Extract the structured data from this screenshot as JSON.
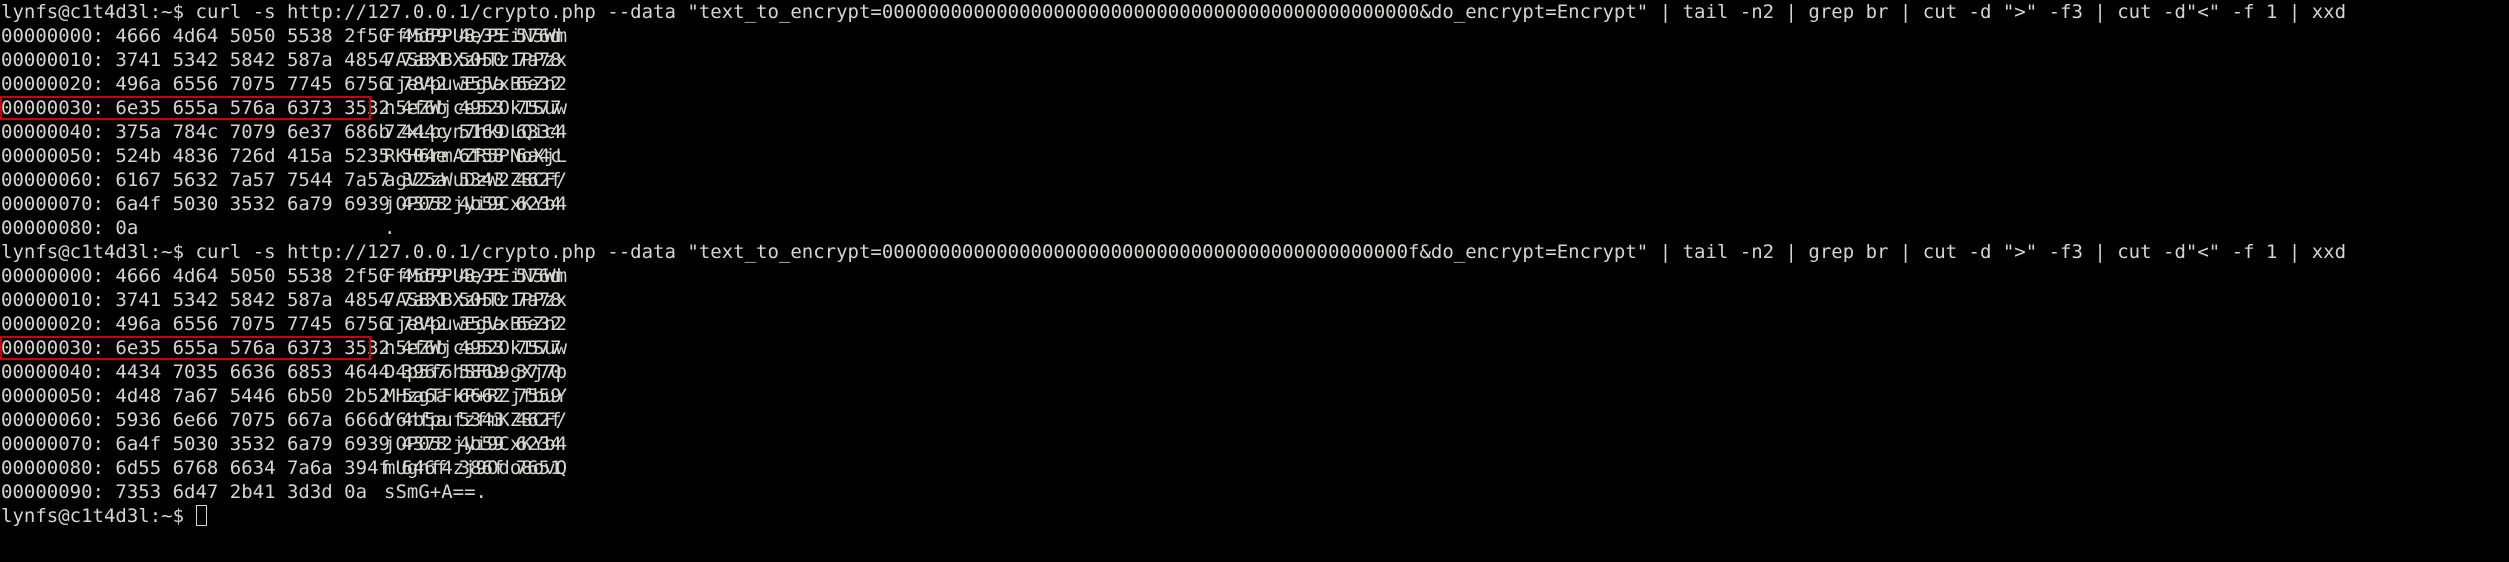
{
  "prompt": {
    "user_host": "lynfs@c1t4d3l",
    "path": ":~",
    "symbol": "$ "
  },
  "commands": [
    "curl -s http://127.0.0.1/crypto.php --data \"text_to_encrypt=00000000000000000000000000000000000000000000000&do_encrypt=Encrypt\" | tail -n2 | grep br | cut -d \">\" -f3 | cut -d\"<\" -f 1 | xxd",
    "curl -s http://127.0.0.1/crypto.php --data \"text_to_encrypt=0000000000000000000000000000000000000000000000f&do_encrypt=Encrypt\" | tail -n2 | grep br | cut -d \">\" -f3 | cut -d\"<\" -f 1 | xxd"
  ],
  "dumps": [
    [
      {
        "offset": "00000000:",
        "hex": "4666 4d64 5050 5538 2f50 4569 4e35 576d",
        "ascii": "FfMdPPU8/PEiN5Wm",
        "highlighted": false
      },
      {
        "offset": "00000010:",
        "hex": "3741 5342 5842 587a 4854 7a31 5050 7a78",
        "ascii": "7ASBXBXzHTz1PPzx",
        "highlighted": false
      },
      {
        "offset": "00000020:",
        "hex": "496a 6556 7075 7745 6756 7842 355a 6e32",
        "ascii": "IjeVpuwEgVxB5Zn2",
        "highlighted": false
      },
      {
        "offset": "00000030:",
        "hex": "6e35 655a 576a 6373 3532 4f6b 4953 7577",
        "ascii": "n5eZWjcs52OkISuw",
        "highlighted": true
      },
      {
        "offset": "00000040:",
        "hex": "375a 784c 7079 6e37 686b 444c 5169 6334",
        "ascii": "7ZxLpyn7hkDLQic4",
        "highlighted": false
      },
      {
        "offset": "00000050:",
        "hex": "524b 4836 726d 415a 5235 504e 6f58 6a4c",
        "ascii": "RKH6rmAZR5PNoXjL",
        "highlighted": false
      },
      {
        "offset": "00000060:",
        "hex": "6167 5632 7a57 7544 7a57 325a 5343 462f",
        "ascii": "agV2zWuDzW2ZSCF/",
        "highlighted": false
      },
      {
        "offset": "00000070:",
        "hex": "6a4f 5030 3532 6a79 6939 4378 4b59 6234",
        "ascii": "jOP052jyi9CxKYb4",
        "highlighted": false
      },
      {
        "offset": "00000080:",
        "hex": "0a",
        "ascii": ".",
        "highlighted": false
      }
    ],
    [
      {
        "offset": "00000000:",
        "hex": "4666 4d64 5050 5538 2f50 4569 4e35 576d",
        "ascii": "FfMdPPU8/PEiN5Wm",
        "highlighted": false
      },
      {
        "offset": "00000010:",
        "hex": "3741 5342 5842 587a 4854 7a31 5050 7a78",
        "ascii": "7ASBXBXzHTz1PPzx",
        "highlighted": false
      },
      {
        "offset": "00000020:",
        "hex": "496a 6556 7075 7745 6756 7842 355a 6e32",
        "ascii": "IjeVpuwEgVxB5Zn2",
        "highlighted": false
      },
      {
        "offset": "00000030:",
        "hex": "6e35 655a 576a 6373 3532 4f6b 4953 7577",
        "ascii": "n5eZWjcs52OkISuw",
        "highlighted": true
      },
      {
        "offset": "00000040:",
        "hex": "4434 7035 6636 6853 4644 3967 586a 3770",
        "ascii": "D4p5f6hSFD9gXj7p",
        "highlighted": false
      },
      {
        "offset": "00000050:",
        "hex": "4d48 7a67 5446 6b50 2b52 5a6a 6662 7559",
        "ascii": "MHzgTFkP+RZjfbuY",
        "highlighted": false
      },
      {
        "offset": "00000060:",
        "hex": "5936 6e66 7075 667a 666d 4b5a 5343 462f",
        "ascii": "Y6nfpufzfmKZSCF/",
        "highlighted": false
      },
      {
        "offset": "00000070:",
        "hex": "6a4f 5030 3532 6a79 6939 4378 4b59 6234",
        "ascii": "jOP052jyi9CxKYb4",
        "highlighted": false
      },
      {
        "offset": "00000080:",
        "hex": "6d55 6768 6634 7a6a 394f 646f 386f 7651",
        "ascii": "mUghf4zj9Odo8ovQ",
        "highlighted": false
      },
      {
        "offset": "00000090:",
        "hex": "7353 6d47 2b41 3d3d 0a",
        "ascii": "sSmG+A==.",
        "highlighted": false
      }
    ]
  ],
  "colors": {
    "background": "#000000",
    "foreground": "#d3d7cf",
    "highlight_border": "#cc0000"
  }
}
